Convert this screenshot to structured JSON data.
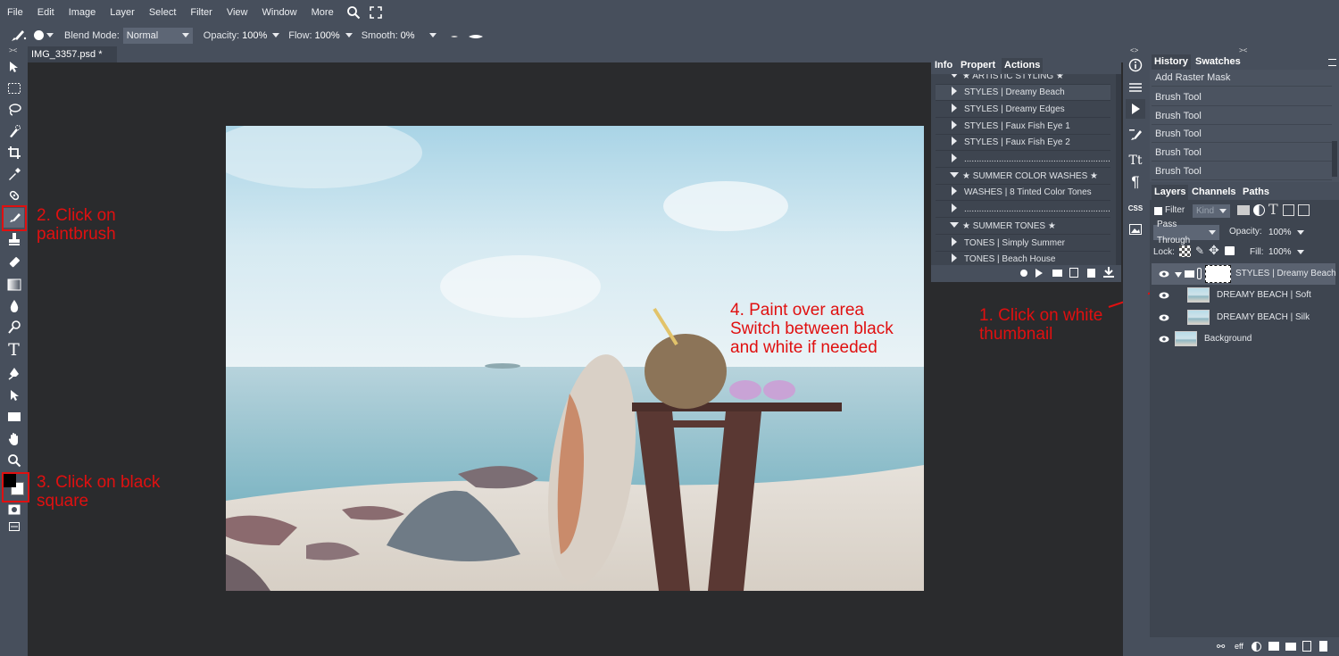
{
  "menu": [
    "File",
    "Edit",
    "Image",
    "Layer",
    "Select",
    "Filter",
    "View",
    "Window",
    "More"
  ],
  "options_bar": {
    "blend_mode_label": "Blend Mode:",
    "blend_mode_value": "Normal",
    "opacity_label": "Opacity:",
    "opacity_value": "100%",
    "flow_label": "Flow:",
    "flow_value": "100%",
    "smooth_label": "Smooth:",
    "smooth_value": "0%"
  },
  "document_tab": {
    "title": "IMG_3357.psd *",
    "close": "✕"
  },
  "annotations": {
    "step1": "1. Click on white\nthumbnail",
    "step2": "2. Click on\npaintbrush",
    "step3": "3. Click on black\nsquare",
    "step4": "4. Paint over area\nSwitch between black\nand white if needed"
  },
  "actions_panel": {
    "tabs": [
      "Info",
      "Propert",
      "Actions"
    ],
    "rows": [
      {
        "type": "group",
        "label": "★ ARTISTIC STYLING ★"
      },
      {
        "type": "item",
        "label": "STYLES | Dreamy Beach"
      },
      {
        "type": "item",
        "label": "STYLES | Dreamy Edges"
      },
      {
        "type": "item",
        "label": "STYLES | Faux Fish Eye 1"
      },
      {
        "type": "item",
        "label": "STYLES | Faux Fish Eye 2"
      },
      {
        "type": "item",
        "label": "............................................................"
      },
      {
        "type": "group",
        "label": "★ SUMMER COLOR WASHES ★"
      },
      {
        "type": "item",
        "label": "WASHES | 8 Tinted Color Tones"
      },
      {
        "type": "item",
        "label": "............................................................"
      },
      {
        "type": "group",
        "label": "★ SUMMER TONES ★"
      },
      {
        "type": "item",
        "label": "TONES | Simply Summer"
      },
      {
        "type": "item",
        "label": "TONES | Beach House"
      }
    ]
  },
  "history_panel": {
    "tabs": [
      "History",
      "Swatches"
    ],
    "items": [
      "Add Raster Mask",
      "Brush Tool",
      "Brush Tool",
      "Brush Tool",
      "Brush Tool",
      "Brush Tool"
    ]
  },
  "layers_panel": {
    "tabs": [
      "Layers",
      "Channels",
      "Paths"
    ],
    "filter_label": "Filter",
    "kind_label": "Kind",
    "blend_value": "Pass Through",
    "opacity_label": "Opacity:",
    "opacity_value": "100%",
    "lock_label": "Lock:",
    "fill_label": "Fill:",
    "fill_value": "100%",
    "layers": [
      {
        "name": "STYLES | Dreamy Beach",
        "kind": "group"
      },
      {
        "name": "DREAMY BEACH | Soft",
        "kind": "layer"
      },
      {
        "name": "DREAMY BEACH | Silk",
        "kind": "layer"
      },
      {
        "name": "Background",
        "kind": "background"
      }
    ],
    "footer": [
      "eff"
    ]
  },
  "icon_strip": [
    "info-icon",
    "sliders-icon",
    "play-icon",
    "brush-settings-icon",
    "character-icon",
    "paragraph-icon",
    "css-icon",
    "image-icon"
  ],
  "icon_strip_css_label": "CSS",
  "colors": {
    "annotation_red": "#e01010",
    "panel": "#474f5c",
    "canvas_bg": "#2a2b2d"
  }
}
